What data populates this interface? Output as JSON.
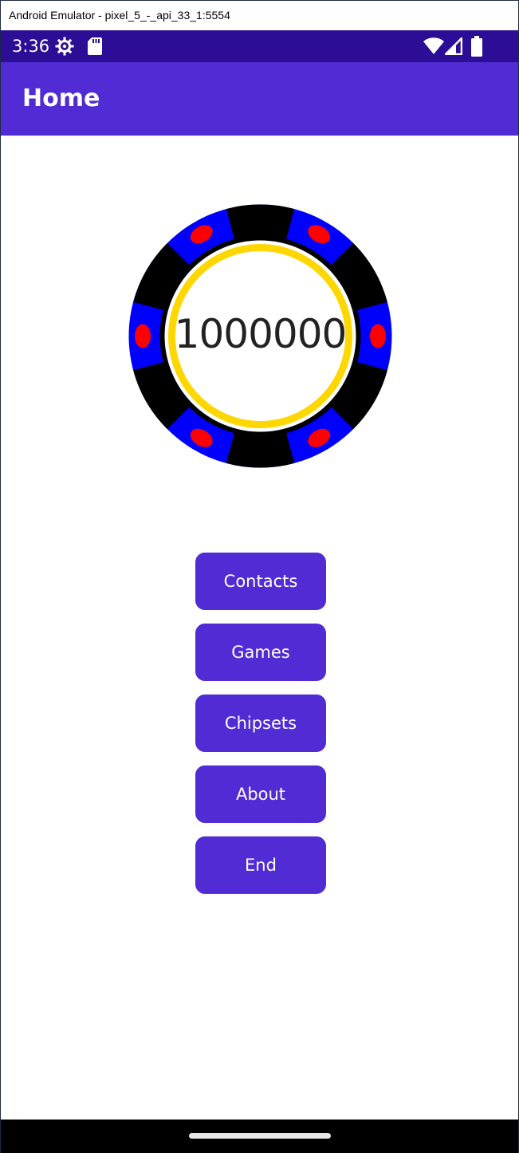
{
  "window": {
    "title": "Android Emulator - pixel_5_-_api_33_1:5554"
  },
  "status_bar": {
    "time": "3:36",
    "icons": [
      "settings-gear-icon",
      "sd-card-icon",
      "wifi-icon",
      "cellular-signal-icon",
      "battery-icon"
    ]
  },
  "app_bar": {
    "title": "Home"
  },
  "chip": {
    "value": "1000000",
    "colors": {
      "outer_ring": "#0000ff",
      "segments": "#000000",
      "spots": "#ff0000",
      "inner_ring": "#ffd700"
    }
  },
  "menu": {
    "buttons": [
      {
        "label": "Contacts"
      },
      {
        "label": "Games"
      },
      {
        "label": "Chipsets"
      },
      {
        "label": "About"
      },
      {
        "label": "End"
      }
    ]
  },
  "colors": {
    "primary": "#512bd4",
    "status_bar": "#2c0e96",
    "nav_bar": "#000000"
  }
}
